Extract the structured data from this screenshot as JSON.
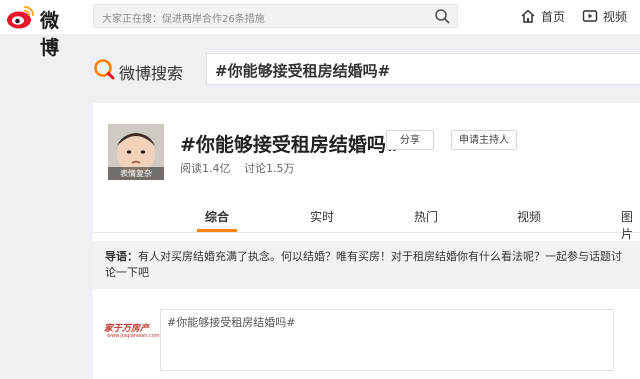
{
  "header": {
    "logo_text": "微博",
    "search_placeholder": "大家正在搜：促进两岸合作26条措施",
    "nav_home": "首页",
    "nav_video": "视频"
  },
  "weibo_search": {
    "label": "微博搜索",
    "query": "#你能够接受租房结婚吗#"
  },
  "topic": {
    "title": "#你能够接受租房结婚吗#",
    "avatar_caption": "表情复杂",
    "share_label": "分享",
    "host_label": "申请主持人",
    "reads": "阅读1.4亿",
    "discussions": "讨论1.5万"
  },
  "tabs": [
    "综合",
    "实时",
    "热门",
    "视频",
    "图片"
  ],
  "active_tab": 0,
  "guide": {
    "label": "导语：",
    "text": "有人对买房结婚充满了执念。何以结婚？唯有买房！对于租房结婚你有什么看法呢？一起参与话题讨论一下吧"
  },
  "composer": {
    "brand_name": "家于万房产",
    "brand_sub": "www.jiaqianwan.com",
    "text": "#你能够接受租房结婚吗#"
  },
  "colors": {
    "accent": "#ff8200",
    "logo_red": "#e6162d"
  }
}
